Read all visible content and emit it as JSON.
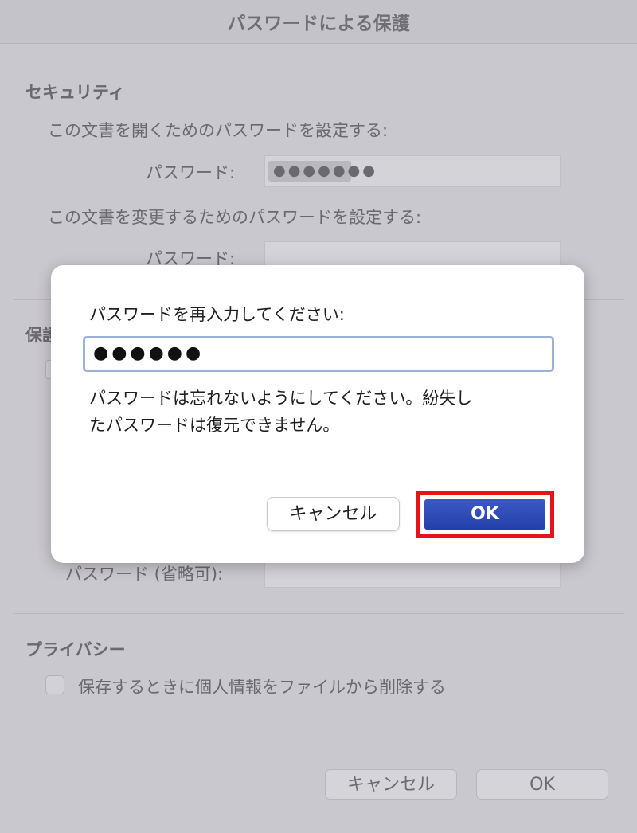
{
  "window": {
    "title": "パスワードによる保護"
  },
  "security": {
    "heading": "セキュリティ",
    "open_desc": "この文書を開くためのパスワードを設定する:",
    "open_label": "パスワード:",
    "open_value": "●●●●●●●",
    "modify_desc": "この文書を変更するためのパスワードを設定する:",
    "modify_label": "パスワード:"
  },
  "protect": {
    "partial_heading": "保護",
    "password_optional_label": "パスワード (省略可):"
  },
  "privacy": {
    "heading": "プライバシー",
    "remove_info_label": "保存するときに個人情報をファイルから削除する",
    "remove_info_checked": false
  },
  "footer": {
    "cancel_label": "キャンセル",
    "ok_label": "OK"
  },
  "dialog": {
    "prompt": "パスワードを再入力してください:",
    "input_value": "●●●●●●",
    "note_line1": "パスワードは忘れないようにしてください。紛失し",
    "note_line2": "たパスワードは復元できません。",
    "cancel_label": "キャンセル",
    "ok_label": "OK",
    "highlight_color": "#e8121b",
    "ok_color": "#2f4bb8"
  }
}
